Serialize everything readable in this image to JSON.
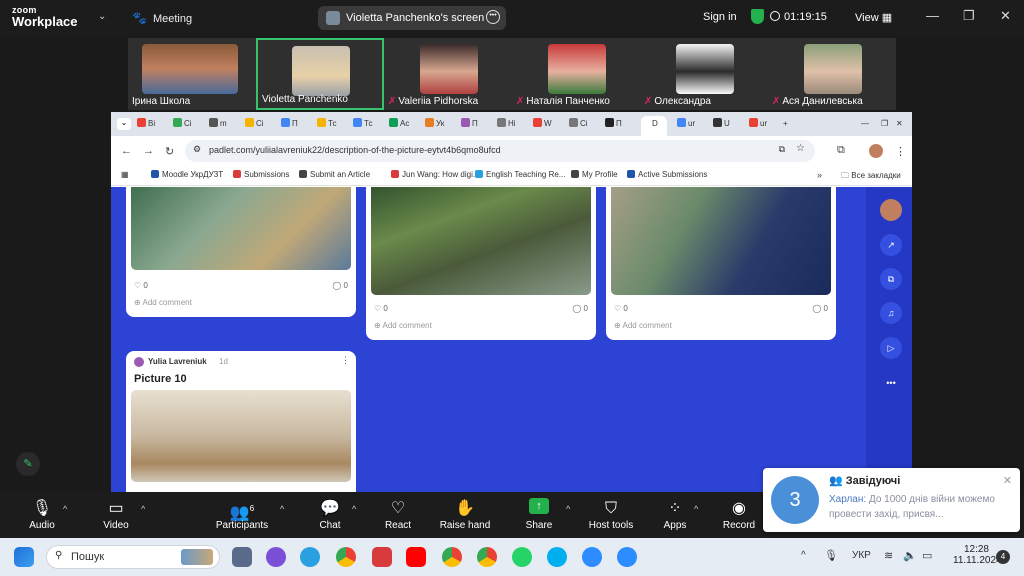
{
  "zoom": {
    "logo_line1": "zoom",
    "logo_line2": "Workplace",
    "meeting_label": "Meeting",
    "share_title": "Violetta Panchenko's screen",
    "sign_in": "Sign in",
    "timer": "01:19:15",
    "view": "View"
  },
  "participants": [
    {
      "name": "Ірина Школа",
      "muted": false
    },
    {
      "name": "Violetta Panchenko",
      "muted": false
    },
    {
      "name": "Valeriia Pidhorska",
      "muted": true
    },
    {
      "name": "Наталія Панченко",
      "muted": true
    },
    {
      "name": "Олександра",
      "muted": true
    },
    {
      "name": "Ася Данилевська",
      "muted": true
    }
  ],
  "browser": {
    "url": "padlet.com/yuliialavreniuk22/description-of-the-picture-eytvt4b6qmo8ufcd",
    "tabs": [
      "Ві",
      "Сі",
      "m",
      "Сі",
      "П",
      "Тс",
      "Тс",
      "Ас",
      "Ук",
      "П",
      "Нi",
      "W",
      "Сі",
      "П",
      "D",
      "ur",
      "U",
      "ur"
    ],
    "bookmarks": [
      "Moodle УкрДУЗТ",
      "Submissions",
      "Submit an Article",
      "Jun Wang: How digi...",
      "English Teaching Re...",
      "My Profile",
      "Active Submissions"
    ],
    "all_bookmarks": "Все закладки"
  },
  "padlet": {
    "likes": [
      "0",
      "0",
      "0"
    ],
    "comments": [
      "0",
      "0",
      "0"
    ],
    "add_comment": "Add comment",
    "post_author": "Yulia Lavreniuk",
    "post_age": "1d",
    "post_title": "Picture 10"
  },
  "toolbar": {
    "audio": "Audio",
    "video": "Video",
    "participants": "Participants",
    "participants_count": "6",
    "chat": "Chat",
    "react": "React",
    "raise_hand": "Raise hand",
    "share": "Share",
    "host_tools": "Host tools",
    "apps": "Apps",
    "record": "Record"
  },
  "notification": {
    "avatar_number": "3",
    "group": "Завідуючі",
    "sender": "Харлан:",
    "message": "До 1000 днів війни можемо провести захід, присвя..."
  },
  "taskbar": {
    "search": "Пошук",
    "lang": "УКР",
    "time": "12:28",
    "date": "11.11.2024",
    "badge": "4"
  },
  "colors": {
    "padlet_bg": "#2d43d3",
    "zoom_bg": "#1c1c1c",
    "active_speaker": "#35c46c",
    "share_green": "#22b14c"
  }
}
